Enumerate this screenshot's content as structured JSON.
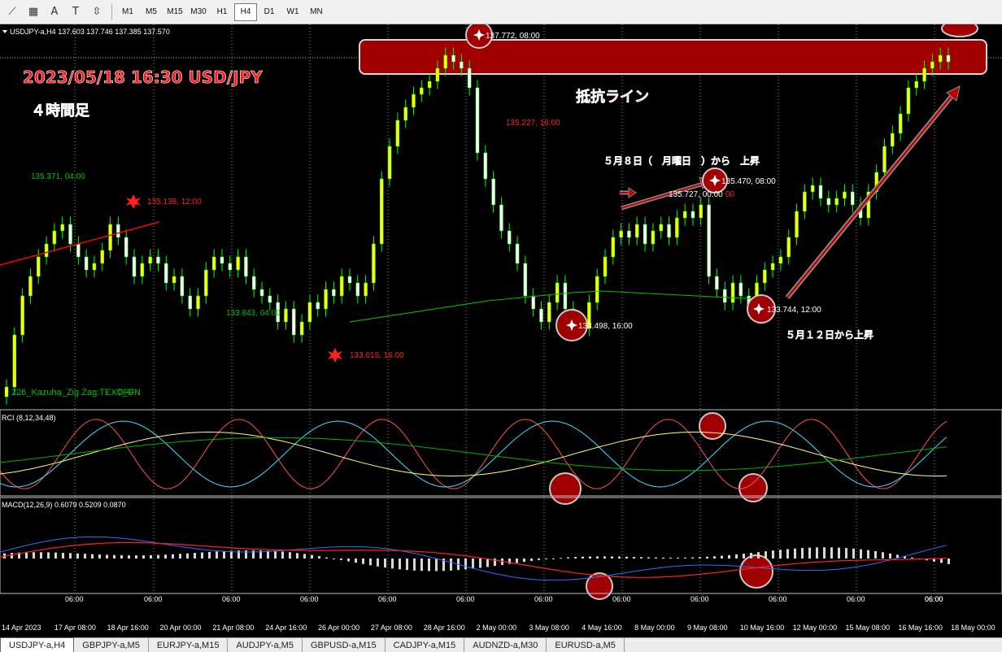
{
  "toolbar": {
    "tools": [
      {
        "icon": "line-study-icon",
        "glyph": "⟋"
      },
      {
        "icon": "grid-icon",
        "glyph": "▦"
      },
      {
        "icon": "text-icon",
        "glyph": "A"
      },
      {
        "icon": "text-label-icon",
        "glyph": "T"
      },
      {
        "icon": "arrows-icon",
        "glyph": "⇳"
      }
    ],
    "timeframes": [
      "M1",
      "M5",
      "M15",
      "M30",
      "H1",
      "H4",
      "D1",
      "W1",
      "MN"
    ],
    "active_timeframe": "H4"
  },
  "chart_header": {
    "symbol_info": "USDJPY-a,H4  137.603 137.746 137.385 137.570",
    "rci_label": "RCI (8,12,34,48)",
    "macd_label": "MACD(12,26,9) 0.6079 0.5209 0.0870",
    "indicator_label": "226_Kazuha_Zig Zag:TEXT_ON",
    "indicator_overlap": "OFF"
  },
  "annotations": {
    "title_line1": "2023/05/18 16:30  USD/JPY",
    "title_line2": "４時間足",
    "resistance": "抵抗ライン",
    "may8": "５月８日（　月曜日　）から　上昇",
    "may12": "５月１２日から上昇"
  },
  "price_labels": {
    "l1": "137.772, 08:00",
    "l2": "135.227, 16:00",
    "l3": "135.371, 04:00",
    "l4": "135.138, 12:00",
    "l5": "133.843, 04:00",
    "l6": "133.015, 16:00",
    "l7": "133.498, 16:00",
    "l8": "135.470, 08:00",
    "l9": "135.727, 00:00",
    "l10": "133.744, 12:00"
  },
  "colors": {
    "bull": "#ffff00",
    "bear": "#ffffff",
    "body_bull": "#00ff00",
    "zigzag_red": "#ff0000",
    "resistance_band": "#a00000",
    "label_green": "#00c000",
    "label_red": "#ff2020"
  },
  "chart_data": {
    "type": "candlestick",
    "symbol": "USDJPY-a",
    "timeframe": "H4",
    "ylim": [
      132.3,
      138.0
    ],
    "x_tick_labels": [
      "14 Apr 2023",
      "17 Apr 08:00",
      "18 Apr 16:00",
      "20 Apr 00:00",
      "21 Apr 08:00",
      "24 Apr 16:00",
      "26 Apr 00:00",
      "27 Apr 08:00",
      "28 Apr 16:00",
      "2 May 00:00",
      "3 May 08:00",
      "4 May 16:00",
      "8 May 00:00",
      "9 May 08:00",
      "10 May 16:00",
      "12 May 00:00",
      "15 May 08:00",
      "16 May 16:00",
      "18 May 00:00"
    ],
    "time_ticks": [
      "06:00",
      "06:00",
      "06:00",
      "06:00",
      "06:00",
      "06:00",
      "06:00",
      "06:00",
      "06:00",
      "06:00",
      "06:00",
      "06:00",
      "06:00"
    ],
    "close_path": [
      132.6,
      133.4,
      134.0,
      134.3,
      134.6,
      134.8,
      135.0,
      135.1,
      134.8,
      134.6,
      134.4,
      134.5,
      134.7,
      135.1,
      134.9,
      134.6,
      134.3,
      134.5,
      134.6,
      134.5,
      134.2,
      134.3,
      134.0,
      133.8,
      134.0,
      134.4,
      134.6,
      134.5,
      134.4,
      134.6,
      134.3,
      134.1,
      134.0,
      133.9,
      133.6,
      133.8,
      133.4,
      133.6,
      133.9,
      133.8,
      134.1,
      134.0,
      134.3,
      134.2,
      134.0,
      134.2,
      134.8,
      135.8,
      136.3,
      136.7,
      136.9,
      137.1,
      137.2,
      137.3,
      137.5,
      137.7,
      137.6,
      137.5,
      137.2,
      136.2,
      135.8,
      135.4,
      135.0,
      134.8,
      134.5,
      134.0,
      133.8,
      133.6,
      133.9,
      134.2,
      133.8,
      133.6,
      133.5,
      133.9,
      134.3,
      134.6,
      134.9,
      135.0,
      134.9,
      135.1,
      134.8,
      135.0,
      135.1,
      134.9,
      135.2,
      135.3,
      135.2,
      135.4,
      134.3,
      134.1,
      133.9,
      134.2,
      134.0,
      133.8,
      134.2,
      134.4,
      134.5,
      134.6,
      134.9,
      135.3,
      135.6,
      135.7,
      135.5,
      135.4,
      135.5,
      135.6,
      135.4,
      135.2,
      135.6,
      135.9,
      136.3,
      136.5,
      136.8,
      137.2,
      137.3,
      137.5,
      137.6,
      137.7,
      137.6
    ],
    "points": [
      {
        "label": "137.772, 08:00",
        "price": 137.772
      },
      {
        "label": "135.227, 16:00",
        "price": 135.227
      },
      {
        "label": "135.371, 04:00",
        "price": 135.371
      },
      {
        "label": "135.138, 12:00",
        "price": 135.138
      },
      {
        "label": "133.843, 04:00",
        "price": 133.843
      },
      {
        "label": "133.015, 16:00",
        "price": 133.015
      },
      {
        "label": "133.498, 16:00",
        "price": 133.498
      },
      {
        "label": "135.470, 08:00",
        "price": 135.47
      },
      {
        "label": "135.727, 00:00",
        "price": 135.727
      },
      {
        "label": "133.744, 12:00",
        "price": 133.744
      }
    ],
    "macd": {
      "main": 0.6079,
      "signal": 0.5209,
      "histogram": 0.087
    }
  },
  "tabs": [
    "USDJPY-a,H4",
    "GBPJPY-a,M5",
    "EURJPY-a,M15",
    "AUDJPY-a,M5",
    "GBPUSD-a,M15",
    "CADJPY-a,M15",
    "AUDNZD-a,M30",
    "EURUSD-a,M5"
  ],
  "active_tab": "USDJPY-a,H4"
}
